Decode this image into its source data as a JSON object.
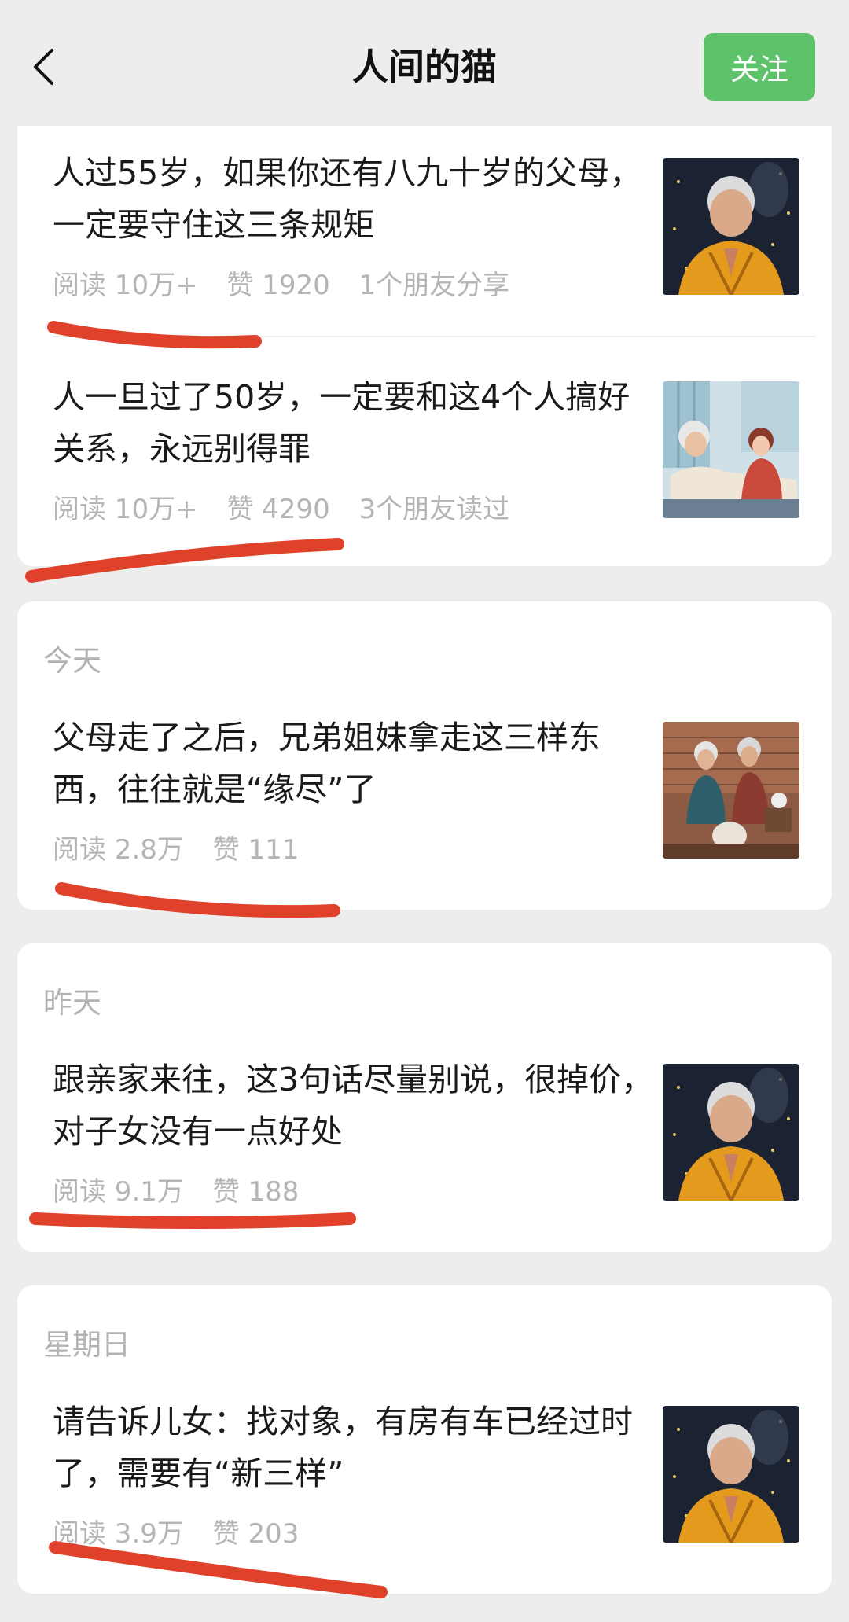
{
  "header": {
    "title": "人间的猫",
    "follow_label": "关注",
    "back_icon": "chevron-left-icon"
  },
  "colors": {
    "follow_button": "#5ec26a",
    "underline": "#e0412a",
    "background": "#ededed"
  },
  "groups": [
    {
      "date": "",
      "articles": [
        {
          "title": "人过55岁，如果你还有八九十岁的父母，一定要守住这三条规矩",
          "reads": "阅读 10万+",
          "likes": "赞 1920",
          "social": "1个朋友分享",
          "thumb": "elderly-woman-praying-image"
        },
        {
          "title": "人一旦过了50岁，一定要和这4个人搞好关系，永远别得罪",
          "reads": "阅读 10万+",
          "likes": "赞 4290",
          "social": "3个朋友读过",
          "thumb": "elderly-man-hospital-nurse-image"
        }
      ]
    },
    {
      "date": "今天",
      "articles": [
        {
          "title": "父母走了之后，兄弟姐妹拿走这三样东西，往往就是“缘尽”了",
          "reads": "阅读 2.8万",
          "likes": "赞 111",
          "social": "",
          "thumb": "elderly-women-tea-image"
        }
      ]
    },
    {
      "date": "昨天",
      "articles": [
        {
          "title": "跟亲家来往，这3句话尽量别说，很掉价，对子女没有一点好处",
          "reads": "阅读 9.1万",
          "likes": "赞 188",
          "social": "",
          "thumb": "elderly-woman-praying-image"
        }
      ]
    },
    {
      "date": "星期日",
      "articles": [
        {
          "title": "请告诉儿女：找对象，有房有车已经过时了，需要有“新三样”",
          "reads": "阅读 3.9万",
          "likes": "赞 203",
          "social": "",
          "thumb": "elderly-woman-praying-image"
        }
      ]
    }
  ]
}
